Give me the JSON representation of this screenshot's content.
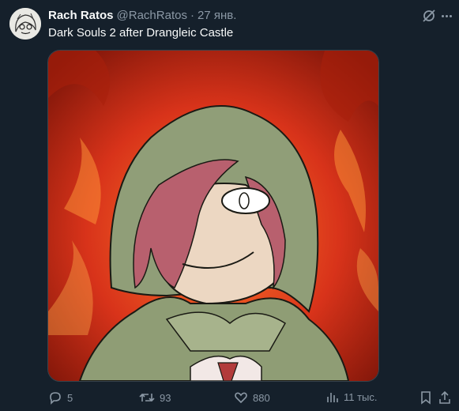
{
  "author": {
    "name": "Rach Ratos",
    "handle": "@RachRatos",
    "separator": "·",
    "date": "27 янв."
  },
  "tweet": {
    "text": "Dark Souls 2 after Drangleic Castle"
  },
  "actions": {
    "replies": "5",
    "retweets": "93",
    "likes": "880",
    "views": "11 тыс."
  },
  "colors": {
    "background": "#15202b",
    "text_primary": "#f7f9f9",
    "text_secondary": "#8b98a5"
  },
  "icons": [
    "grok-icon",
    "more-icon",
    "reply-icon",
    "retweet-icon",
    "like-icon",
    "views-icon",
    "bookmark-icon"
  ]
}
